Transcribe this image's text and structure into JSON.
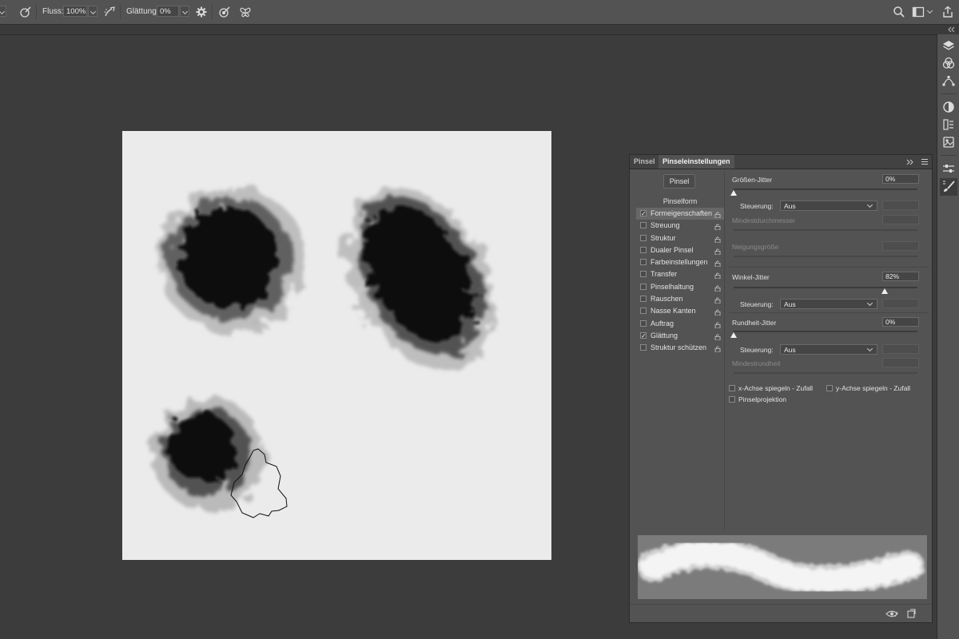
{
  "options_bar": {
    "flow_label": "Fluss:",
    "flow_value": "100%",
    "smoothing_label": "Glättung:",
    "smoothing_value": "0%"
  },
  "panel": {
    "tabs": [
      "Pinsel",
      "Pinseleinstellungen"
    ],
    "presets_button": "Pinsel",
    "section_heading": "Pinselform",
    "items": [
      {
        "label": "Formeigenschaften",
        "checked": true,
        "selected": true
      },
      {
        "label": "Streuung",
        "checked": false
      },
      {
        "label": "Struktur",
        "checked": false
      },
      {
        "label": "Dualer Pinsel",
        "checked": false
      },
      {
        "label": "Farbeinstellungen",
        "checked": false
      },
      {
        "label": "Transfer",
        "checked": false
      },
      {
        "label": "Pinselhaltung",
        "checked": false
      },
      {
        "label": "Rauschen",
        "checked": false
      },
      {
        "label": "Nasse Kanten",
        "checked": false
      },
      {
        "label": "Auftrag",
        "checked": false
      },
      {
        "label": "Glättung",
        "checked": true
      },
      {
        "label": "Struktur schützen",
        "checked": false
      }
    ],
    "size_jitter": {
      "label": "Größen-Jitter",
      "value": "0%",
      "fraction": 0.0
    },
    "control_label": "Steuerung:",
    "control_value": "Aus",
    "min_diameter_label": "Mindestdurchmesser",
    "tilt_scale_label": "Neigungsgröße",
    "angle_jitter": {
      "label": "Winkel-Jitter",
      "value": "82%",
      "fraction": 0.82
    },
    "roundness_jitter": {
      "label": "Rundheit-Jitter",
      "value": "0%",
      "fraction": 0.0
    },
    "min_roundness_label": "Mindestrundheit",
    "flip_x": "x-Achse spiegeln - Zufall",
    "flip_y": "y-Achse spiegeln - Zufall",
    "projection": "Pinselprojektion"
  }
}
